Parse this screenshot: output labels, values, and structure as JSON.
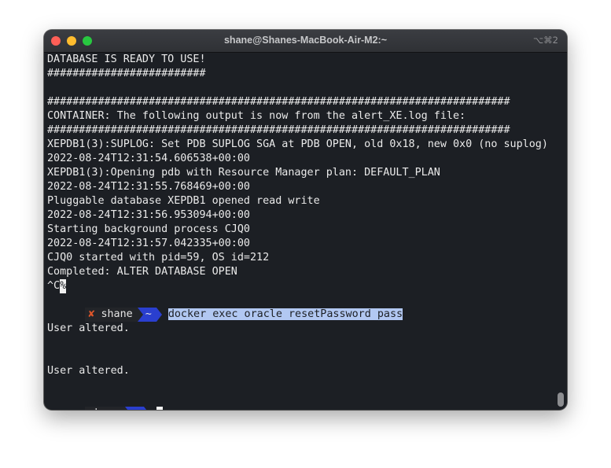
{
  "window": {
    "title": "shane@Shanes-MacBook-Air-M2:~",
    "shortcut": "⌥⌘2"
  },
  "terminal": {
    "lines": [
      "DATABASE IS READY TO USE!",
      "#########################",
      "",
      "#########################################################################",
      "CONTAINER: The following output is now from the alert_XE.log file:",
      "#########################################################################",
      "XEPDB1(3):SUPLOG: Set PDB SUPLOG SGA at PDB OPEN, old 0x18, new 0x0 (no suplog)",
      "2022-08-24T12:31:54.606538+00:00",
      "XEPDB1(3):Opening pdb with Resource Manager plan: DEFAULT_PLAN",
      "2022-08-24T12:31:55.768469+00:00",
      "Pluggable database XEPDB1 opened read write",
      "2022-08-24T12:31:56.953094+00:00",
      "Starting background process CJQ0",
      "2022-08-24T12:31:57.042335+00:00",
      "CJQ0 started with pid=59, OS id=212",
      "Completed: ALTER DATABASE OPEN"
    ],
    "interrupt_text": "^C",
    "interrupt_mark": "%",
    "prompt1": {
      "status": "✘",
      "user": "shane",
      "dir": "~",
      "command": "docker exec oracle resetPassword pass"
    },
    "output1": "User altered.",
    "output2": "User altered.",
    "prompt2": {
      "user": "shane",
      "dir": "~"
    }
  }
}
